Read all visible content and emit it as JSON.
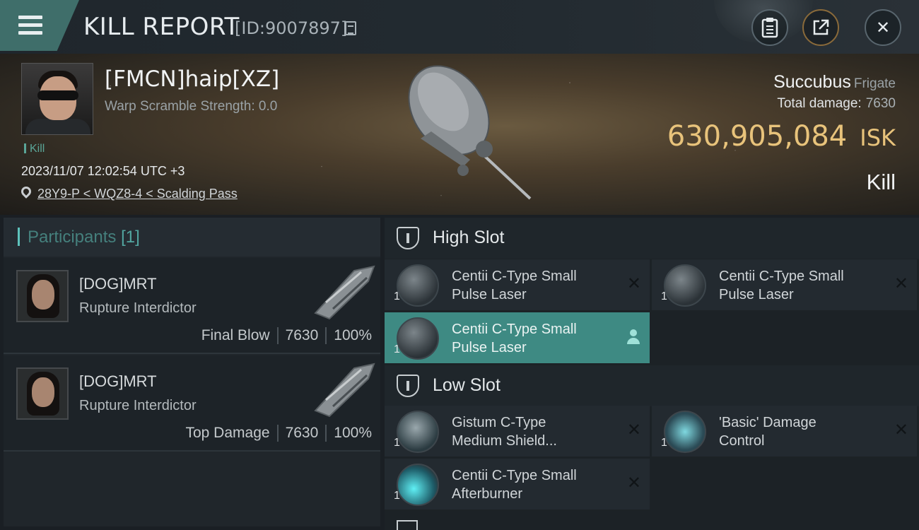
{
  "header": {
    "title": "KILL REPORT",
    "report_id": "[ID:9007897]",
    "close_glyph": "✕",
    "icons": [
      "menu-icon",
      "copy-icon",
      "clipboard-icon",
      "share-icon",
      "close-icon"
    ]
  },
  "victim": {
    "name": "[FMCN]haip[XZ]",
    "warp_scramble": "Warp Scramble Strength: 0.0",
    "kill_tag": "Kill",
    "datetime": "2023/11/07 12:02:54 UTC +3",
    "location": "28Y9-P < WQZ8-4 < Scalding Pass",
    "ship_name": "Succubus",
    "ship_class": "Frigate",
    "total_damage_label": "Total damage:",
    "total_damage_value": "7630",
    "isk_value": "630,905,084",
    "isk_unit": "ISK",
    "result": "Kill"
  },
  "participants": {
    "title": "Participants",
    "count": "[1]",
    "rows": [
      {
        "name": "[DOG]MRT",
        "ship": "Rupture Interdictor",
        "tag": "Final Blow",
        "damage": "7630",
        "percent": "100%"
      },
      {
        "name": "[DOG]MRT",
        "ship": "Rupture Interdictor",
        "tag": "Top Damage",
        "damage": "7630",
        "percent": "100%"
      }
    ]
  },
  "slots": {
    "high": {
      "title": "High Slot",
      "modules": [
        {
          "name_1": "Centii C-Type Small",
          "name_2": "Pulse Laser",
          "qty": "1",
          "status": "destroyed"
        },
        {
          "name_1": "Centii C-Type Small",
          "name_2": "Pulse Laser",
          "qty": "1",
          "status": "destroyed"
        },
        {
          "name_1": "Centii C-Type Small",
          "name_2": "Pulse Laser",
          "qty": "1",
          "status": "dropped"
        }
      ]
    },
    "low": {
      "title": "Low Slot",
      "modules": [
        {
          "name_1": "Gistum C-Type",
          "name_2": "Medium Shield...",
          "qty": "1",
          "status": "destroyed"
        },
        {
          "name_1": "'Basic' Damage",
          "name_2": "Control",
          "qty": "1",
          "status": "destroyed"
        },
        {
          "name_1": "Centii C-Type Small",
          "name_2": "Afterburner",
          "qty": "1",
          "status": "destroyed"
        }
      ]
    }
  },
  "colors": {
    "accent_teal": "#3e8a83",
    "isk_gold": "#e8c37b",
    "menu_tab": "#3f6e6a"
  }
}
